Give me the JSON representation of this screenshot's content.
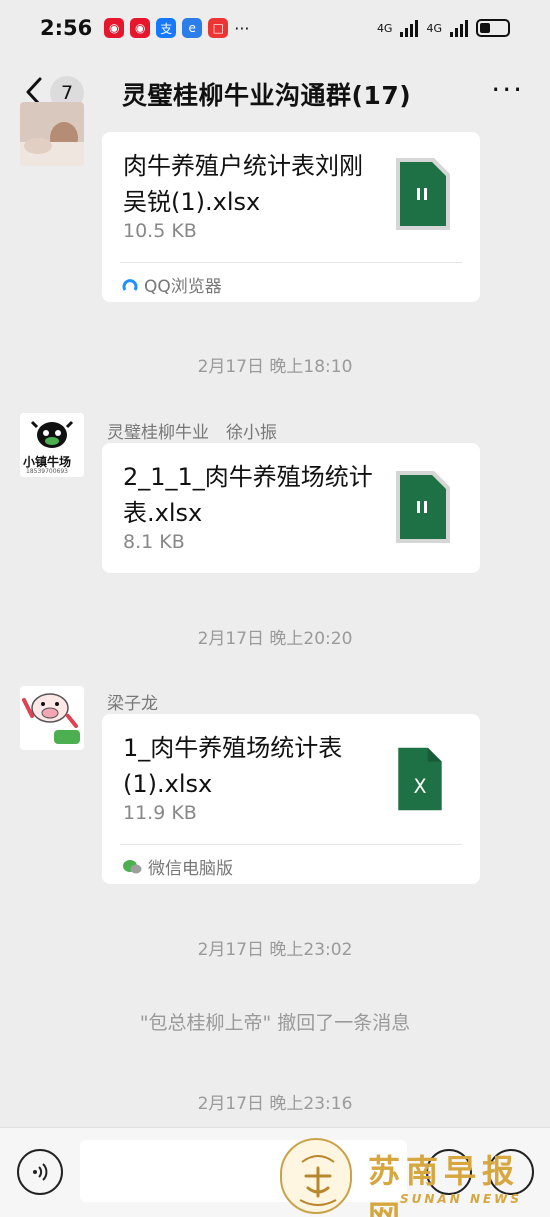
{
  "status_bar": {
    "time": "2:56",
    "network_1": "4G",
    "network_2": "4G",
    "app_icons": [
      "weibo-icon",
      "weibo-icon",
      "alipay-icon",
      "browser-icon",
      "app-icon",
      "more-icon"
    ]
  },
  "header": {
    "back_count": "7",
    "title": "灵璧桂柳牛业沟通群(17)",
    "more": "···"
  },
  "messages": [
    {
      "file_name": "肉牛养殖户统计表刘刚吴锐(1).xlsx",
      "file_size": "10.5 KB",
      "source": "QQ浏览器",
      "file_icon": "pause-icon"
    },
    {
      "timestamp": "2月17日 晚上18:10"
    },
    {
      "sender": "灵璧桂柳牛业　徐小振",
      "avatar_text": "小镇牛场",
      "avatar_subtext": "18539700693",
      "file_name": "2_1_1_肉牛养殖场统计表.xlsx",
      "file_size": "8.1 KB",
      "file_icon": "pause-icon"
    },
    {
      "timestamp": "2月17日 晚上20:20"
    },
    {
      "sender": "梁子龙",
      "file_name": "1_肉牛养殖场统计表(1).xlsx",
      "file_size": "11.9 KB",
      "file_icon_letter": "X",
      "source": "微信电脑版"
    },
    {
      "timestamp": "2月17日 晚上23:02"
    },
    {
      "system": "\"包总桂柳上帝\" 撤回了一条消息"
    },
    {
      "timestamp": "2月17日 晚上23:16"
    }
  ],
  "watermark": {
    "title": "苏南早报网",
    "sub": "SUNAN NEWS"
  },
  "colors": {
    "excel_green": "#1e7145",
    "excel_dark": "#185c37",
    "background": "#ededed",
    "bubble": "#ffffff",
    "meta_gray": "#9a9a9a"
  }
}
